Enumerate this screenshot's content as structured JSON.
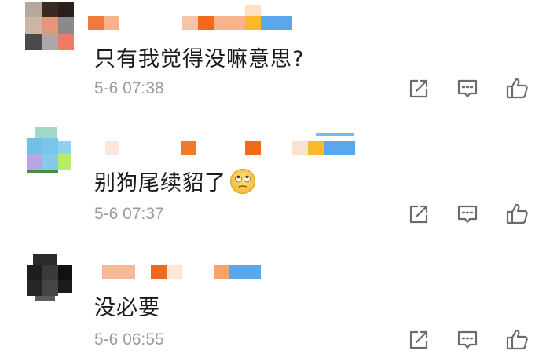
{
  "comments": [
    {
      "text": "只有我觉得没嘛意思?",
      "emoji": "",
      "time": "5-6 07:38"
    },
    {
      "text": "别狗尾续貂了",
      "emoji": "rolling-eyes-emoji",
      "time": "5-6 07:37"
    },
    {
      "text": "没必要",
      "emoji": "",
      "time": "5-6 06:55"
    }
  ],
  "icons": {
    "share": "share-icon",
    "reply": "comment-icon",
    "like": "thumbs-up-icon"
  },
  "colors": {
    "text": "#1a1a1a",
    "time": "#9b9b9b",
    "icon": "#6b6b6b",
    "divider": "#ebebeb"
  }
}
